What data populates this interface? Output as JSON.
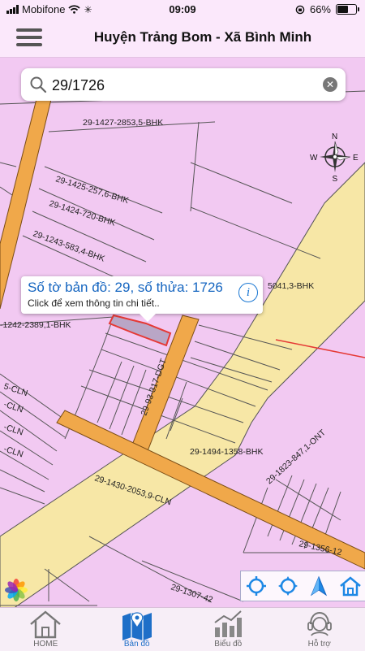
{
  "status_bar": {
    "carrier": "Mobifone",
    "time": "09:09",
    "battery_percent": "66%",
    "battery_level": 0.66
  },
  "header": {
    "title": "Huyện Trảng Bom - Xã Bình Minh",
    "menu_icon": "hamburger-menu-icon"
  },
  "search": {
    "value": "29/1726",
    "placeholder": "",
    "clear_icon": "clear-icon"
  },
  "compass": {
    "labels": [
      "N",
      "S",
      "E",
      "W"
    ]
  },
  "popup": {
    "title": "Số tờ bản đồ: 29, số thửa: 1726",
    "subtitle": "Click để xem thông tin chi tiết..",
    "info_glyph": "i"
  },
  "map_labels": {
    "l1": "29-1427-2853,5-BHK",
    "l2": "29-1425-257,6-BHK",
    "l3": "29-1424-720-BHK",
    "l4": "29-1243-583,4-BHK",
    "l5": "5041,3-BHK",
    "l6": "-1242-2389,1-BHK",
    "l7": "29-93-317-DGT",
    "l8": "29-1494-1358-BHK",
    "l9": "29-1823-847,1-ONT",
    "l10": "29-1430-2053,9-CLN",
    "l11": "29-1356-12",
    "l12": "29-1307-42",
    "l13": "5-CLN",
    "l14": "-CLN",
    "l15": "-CLN",
    "l16": "-CLN"
  },
  "map_tools": [
    "locate-icon",
    "gps-icon",
    "navigate-icon",
    "home-map-icon"
  ],
  "bottom_nav": {
    "items": [
      {
        "label": "HOME",
        "icon": "home-icon"
      },
      {
        "label": "Bản đồ",
        "icon": "map-icon"
      },
      {
        "label": "Biểu đồ",
        "icon": "chart-icon"
      },
      {
        "label": "Hỗ trợ",
        "icon": "support-icon"
      }
    ],
    "active_index": 1
  },
  "colors": {
    "background": "#f2c9f2",
    "road_orange": "#f0a84a",
    "road_yellow": "#f7e7a6",
    "accent_blue": "#1565c0",
    "selected_parcel": "#b9a6c6",
    "parcel_border_red": "#e53935"
  }
}
